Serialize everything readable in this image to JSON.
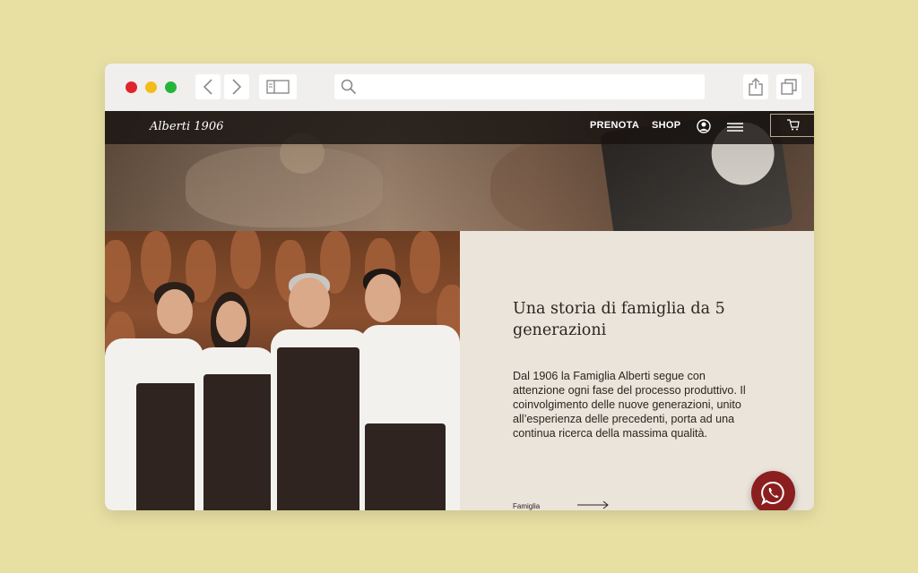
{
  "browser": {
    "traffic_lights": [
      "close",
      "minimize",
      "zoom"
    ],
    "back_icon": "chevron-left-icon",
    "forward_icon": "chevron-right-icon",
    "sidebar_icon": "sidebar-icon",
    "search_icon": "search-icon",
    "address_value": "",
    "share_icon": "share-icon",
    "tabs_icon": "tabs-icon"
  },
  "nav": {
    "logo": "Alberti 1906",
    "links": [
      "PRENOTA",
      "SHOP"
    ],
    "account_icon": "user-icon",
    "menu_icon": "hamburger-icon",
    "cart_icon": "cart-icon"
  },
  "section": {
    "heading": "Una storia di famiglia da 5 generazioni",
    "body": "Dal 1906 la Famiglia Alberti segue con attenzione ogni fase del processo produttivo. Il coinvolgimento delle nuove generazioni, unito all’esperienza delle precedenti, porta ad una continua ricerca della massima qualità.",
    "link_label": "Famiglia",
    "arrow_icon": "arrow-right-icon"
  },
  "whatsapp": {
    "icon": "whatsapp-icon",
    "color": "#8b1e1f"
  },
  "colors": {
    "page_bg": "#e8e0a3",
    "panel_bg": "#ebe4da",
    "text": "#2b2520"
  }
}
